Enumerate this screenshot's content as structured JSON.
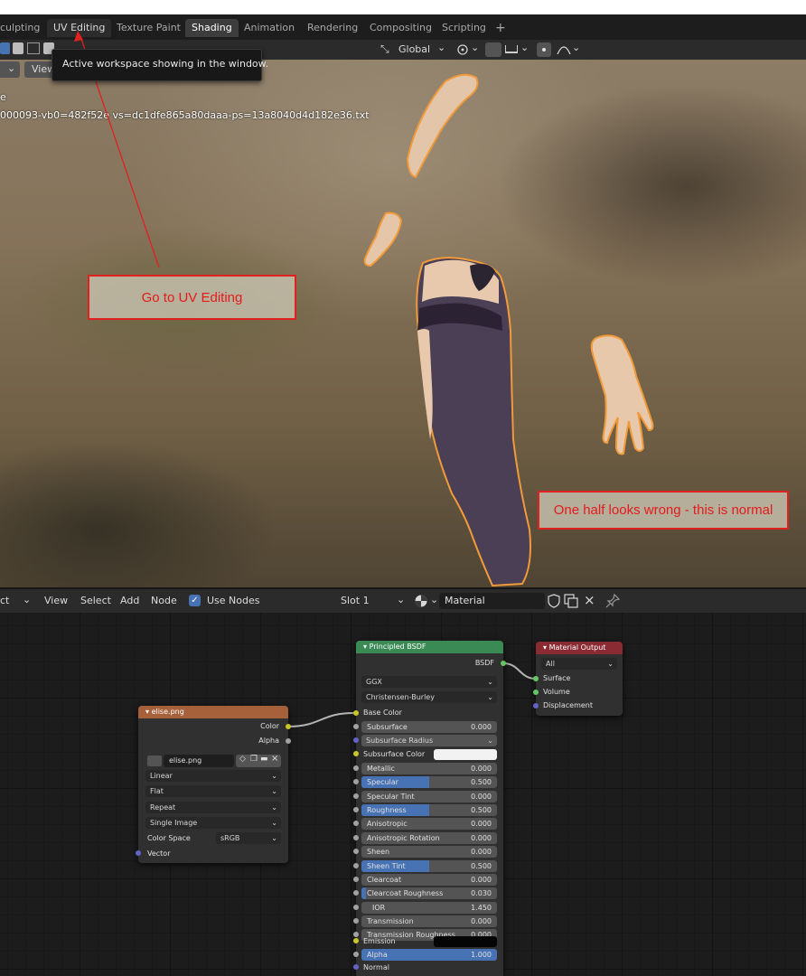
{
  "workspace_tabs": [
    {
      "label": "culpting",
      "state": "normal"
    },
    {
      "label": "UV Editing",
      "state": "hover"
    },
    {
      "label": "Texture Paint",
      "state": "normal"
    },
    {
      "label": "Shading",
      "state": "active"
    },
    {
      "label": "Animation",
      "state": "normal"
    },
    {
      "label": "Rendering",
      "state": "normal"
    },
    {
      "label": "Compositing",
      "state": "normal"
    },
    {
      "label": "Scripting",
      "state": "normal"
    }
  ],
  "add_tab_glyph": "+",
  "tooltip": {
    "text": "Active workspace showing in the window."
  },
  "viewport_header": {
    "view_menu": "View",
    "transform_orientation": "Global",
    "dropdown_glyph": "⌄"
  },
  "viewport_overlay": {
    "line1": "e",
    "line2": "000093-vb0=482f52e  vs=dc1dfe865a80daaa-ps=13a8040d4d182e36.txt"
  },
  "annotations": [
    {
      "text": "Go to UV Editing"
    },
    {
      "text": "One half looks wrong - this is normal"
    }
  ],
  "node_editor_header": {
    "mode_label": "ct",
    "menus": [
      "View",
      "Select",
      "Add",
      "Node"
    ],
    "use_nodes_label": "Use Nodes",
    "use_nodes_checked": true,
    "slot": "Slot 1",
    "material_name": "Material"
  },
  "image_node": {
    "title": "elise.png",
    "outputs": [
      "Color",
      "Alpha"
    ],
    "image_name": "elise.png",
    "interpolation": "Linear",
    "projection": "Flat",
    "extension": "Repeat",
    "source": "Single Image",
    "color_space_label": "Color Space",
    "color_space": "sRGB",
    "input_vector": "Vector"
  },
  "bsdf_node": {
    "title": "Principled BSDF",
    "output": "BSDF",
    "distribution": "GGX",
    "subsurface_method": "Christensen-Burley",
    "base_color_label": "Base Color",
    "subsurface_color_label": "Subsurface Color",
    "emission_label": "Emission",
    "normal_label": "Normal",
    "subsurface_radius_label": "Subsurface Radius",
    "sliders": [
      {
        "label": "Subsurface",
        "value": "0.000",
        "fill": 0.0
      },
      {
        "label": "Metallic",
        "value": "0.000",
        "fill": 0.0
      },
      {
        "label": "Specular",
        "value": "0.500",
        "fill": 0.5
      },
      {
        "label": "Specular Tint",
        "value": "0.000",
        "fill": 0.0
      },
      {
        "label": "Roughness",
        "value": "0.500",
        "fill": 0.5
      },
      {
        "label": "Anisotropic",
        "value": "0.000",
        "fill": 0.0
      },
      {
        "label": "Anisotropic Rotation",
        "value": "0.000",
        "fill": 0.0
      },
      {
        "label": "Sheen",
        "value": "0.000",
        "fill": 0.0
      },
      {
        "label": "Sheen Tint",
        "value": "0.500",
        "fill": 0.5
      },
      {
        "label": "Clearcoat",
        "value": "0.000",
        "fill": 0.0
      },
      {
        "label": "Clearcoat Roughness",
        "value": "0.030",
        "fill": 0.03
      },
      {
        "label": "IOR",
        "value": "1.450",
        "fill": 0.0
      },
      {
        "label": "Transmission",
        "value": "0.000",
        "fill": 0.0
      },
      {
        "label": "Transmission Roughness",
        "value": "0.000",
        "fill": 0.0
      },
      {
        "label": "Alpha",
        "value": "1.000",
        "fill": 1.0
      }
    ]
  },
  "output_node": {
    "title": "Material Output",
    "target": "All",
    "inputs": [
      "Surface",
      "Volume",
      "Displacement"
    ]
  },
  "colors": {
    "annotation_red": "#e12020",
    "image_node_header": "#a6603a",
    "bsdf_node_header": "#3a8a55",
    "output_node_header": "#8a2a33",
    "accent_blue": "#4772b3"
  }
}
